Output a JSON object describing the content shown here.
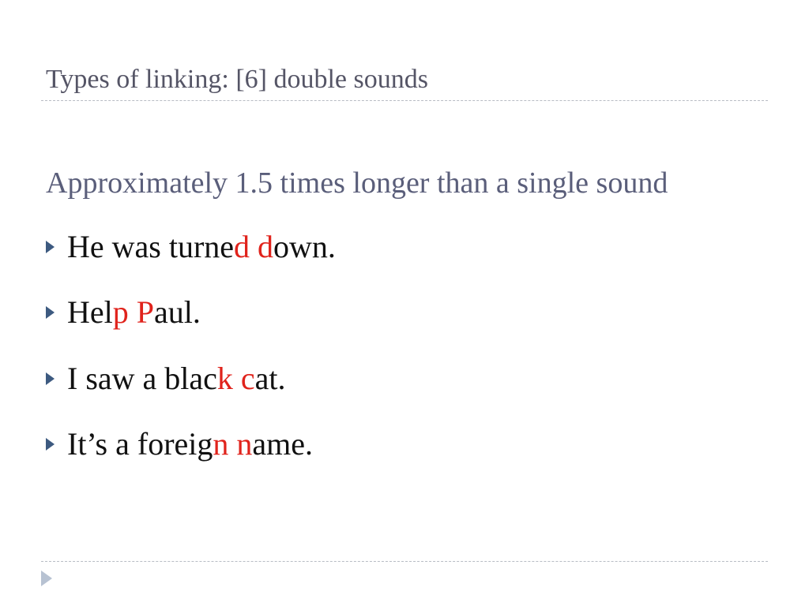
{
  "slide": {
    "title": "Types of linking: [6] double sounds",
    "subtitle": "Approximately 1.5 times longer than a single sound",
    "bullets": [
      {
        "pre": "He was turne",
        "hl1": "d",
        "mid": " ",
        "hl2": "d",
        "post": "own."
      },
      {
        "pre": "Hel",
        "hl1": "p",
        "mid": " ",
        "hl2": "P",
        "post": "aul."
      },
      {
        "pre": "I saw a blac",
        "hl1": "k",
        "mid": " ",
        "hl2": "c",
        "post": "at."
      },
      {
        "pre": "It’s a foreig",
        "hl1": "n",
        "mid": " ",
        "hl2": "n",
        "post": "ame."
      }
    ]
  },
  "icons": {
    "bullet": "triangle-right-icon",
    "nav": "triangle-right-icon"
  },
  "colors": {
    "title": "#555566",
    "subtitle": "#5a5e7a",
    "body": "#111111",
    "highlight": "#e0231c",
    "bullet_arrow": "#3d5a80",
    "rule": "#b8bcc4",
    "nav_arrow": "#b7c2d2"
  }
}
